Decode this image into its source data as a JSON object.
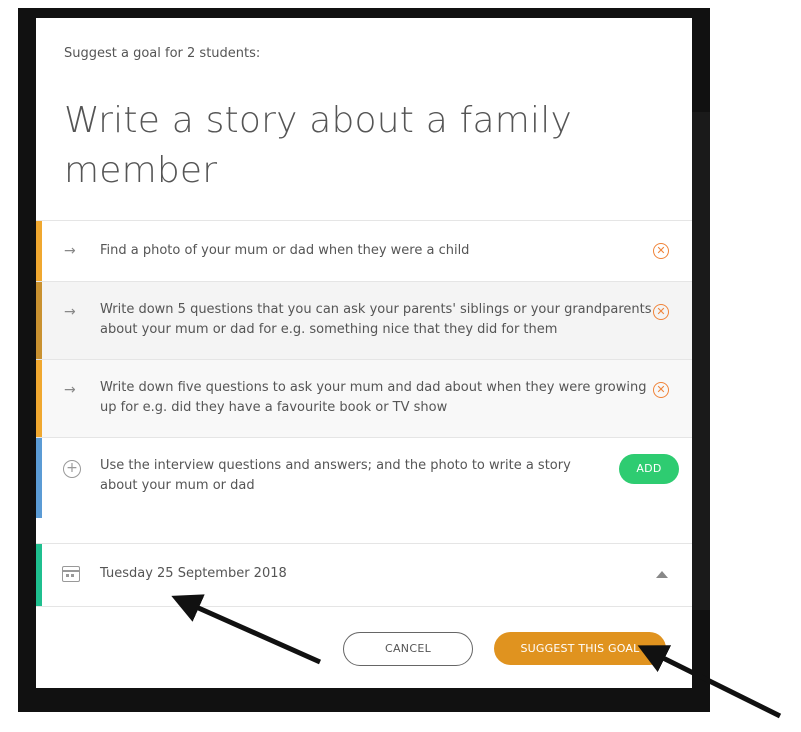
{
  "header": {
    "subtitle": "Suggest a goal for 2 students:",
    "title": "Write a story about a family member"
  },
  "tasks": [
    {
      "text": "Find a photo of your mum or dad when they were a child",
      "accent": "#f0a830"
    },
    {
      "text": "Write down 5 questions that you can ask your parents' siblings or your grandparents about your mum or dad for e.g. something nice that they did for them",
      "accent": "#c99130"
    },
    {
      "text": "Write down five questions to ask your mum and dad about when they were growing up for e.g. did they have a favourite book or TV show",
      "accent": "#f0a830"
    }
  ],
  "new_task": {
    "text": "Use the interview questions and answers; and the photo to write a story about your mum or dad",
    "add_label": "ADD",
    "accent": "#5b9bd5"
  },
  "due_date": {
    "label": "Tuesday 25 September 2018",
    "accent": "#1fbf8f"
  },
  "footer": {
    "cancel_label": "CANCEL",
    "suggest_label": "SUGGEST THIS GOAL"
  },
  "colors": {
    "remove_icon": "#f0843a",
    "add_button": "#2ecc71",
    "suggest_button": "#e0931f"
  },
  "icons": {
    "task_arrow": "arrow-right-icon",
    "remove": "remove-circle-icon",
    "add_task": "plus-circle-icon",
    "date": "calendar-icon",
    "collapse": "caret-up-icon"
  }
}
